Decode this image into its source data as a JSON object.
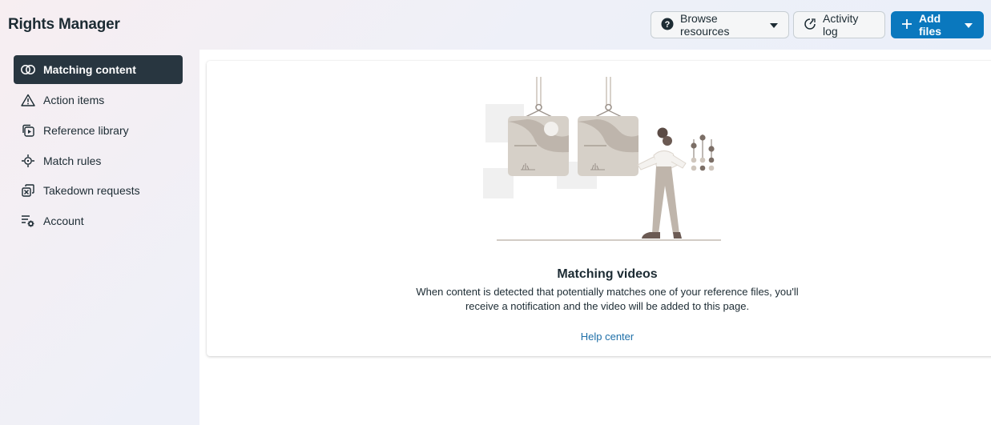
{
  "app": {
    "title": "Rights Manager"
  },
  "header": {
    "browse_label": "Browse resources",
    "activity_label": "Activity log",
    "add_label": "Add files"
  },
  "sidebar": {
    "items": [
      {
        "label": "Matching content",
        "icon": "matching-icon",
        "active": true
      },
      {
        "label": "Action items",
        "icon": "warning-icon",
        "active": false
      },
      {
        "label": "Reference library",
        "icon": "library-icon",
        "active": false
      },
      {
        "label": "Match rules",
        "icon": "crosshair-icon",
        "active": false
      },
      {
        "label": "Takedown requests",
        "icon": "takedown-icon",
        "active": false
      },
      {
        "label": "Account",
        "icon": "settings-list-icon",
        "active": false
      }
    ]
  },
  "empty_state": {
    "title": "Matching videos",
    "description": "When content is detected that potentially matches one of your reference files, you'll receive a notification and the video will be added to this page.",
    "link": "Help center"
  },
  "colors": {
    "primary": "#0a78be",
    "active_nav": "#283640",
    "link": "#1e6fa8"
  }
}
